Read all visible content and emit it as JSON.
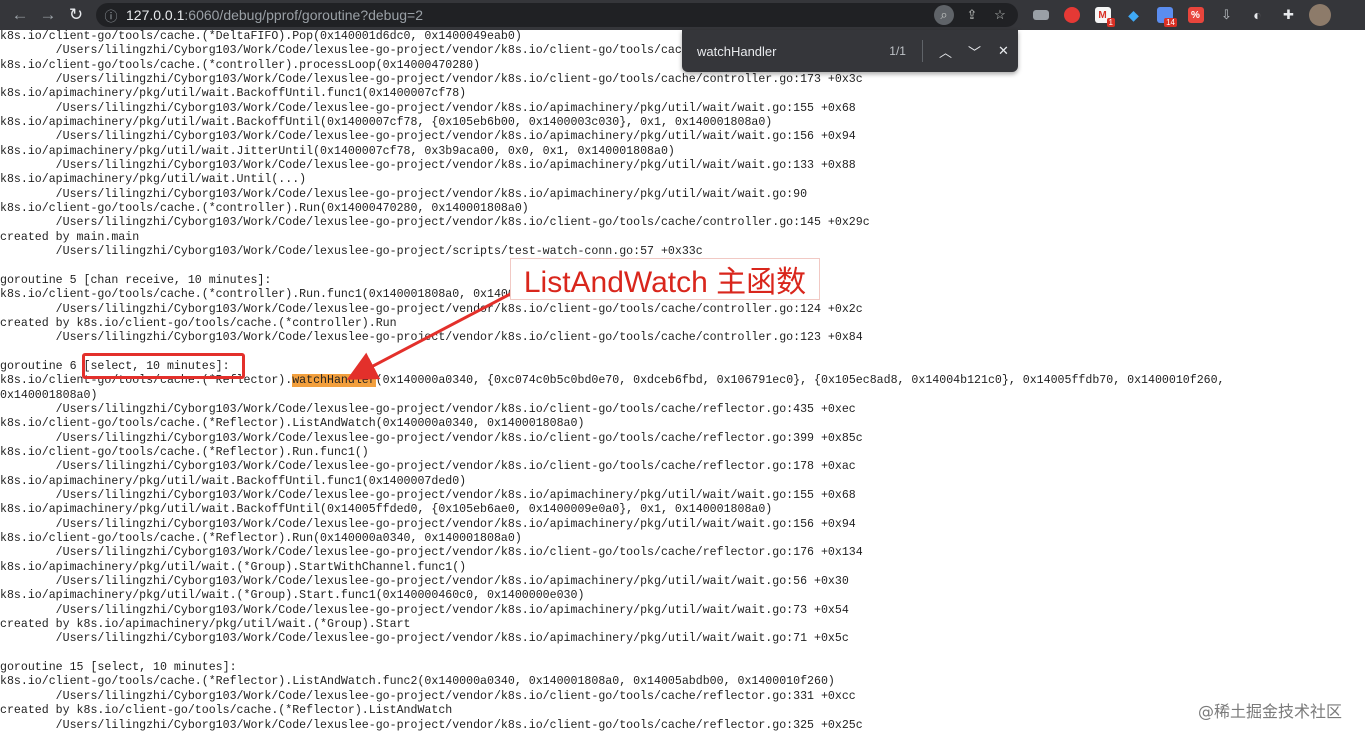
{
  "browser": {
    "url_host": "127.0.0.1",
    "url_rest": ":6060/debug/pprof/goroutine?debug=2",
    "extension_badges": [
      "1",
      "14"
    ]
  },
  "find_bar": {
    "query": "watchHandler",
    "match_count": "1/1"
  },
  "lines": [
    "k8s.io/client-go/tools/cache.(*DeltaFIFO).Pop(0x140001d6dc0, 0x1400049eab0)",
    "        /Users/lilingzhi/Cyborg103/Work/Code/lexuslee-go-project/vendor/k8s.io/client-go/tools/cache/delta_fifo.go:507 +0x1f0",
    "k8s.io/client-go/tools/cache.(*controller).processLoop(0x14000470280)",
    "        /Users/lilingzhi/Cyborg103/Work/Code/lexuslee-go-project/vendor/k8s.io/client-go/tools/cache/controller.go:173 +0x3c",
    "k8s.io/apimachinery/pkg/util/wait.BackoffUntil.func1(0x1400007cf78)",
    "        /Users/lilingzhi/Cyborg103/Work/Code/lexuslee-go-project/vendor/k8s.io/apimachinery/pkg/util/wait/wait.go:155 +0x68",
    "k8s.io/apimachinery/pkg/util/wait.BackoffUntil(0x1400007cf78, {0x105eb6b00, 0x1400003c030}, 0x1, 0x140001808a0)",
    "        /Users/lilingzhi/Cyborg103/Work/Code/lexuslee-go-project/vendor/k8s.io/apimachinery/pkg/util/wait/wait.go:156 +0x94",
    "k8s.io/apimachinery/pkg/util/wait.JitterUntil(0x1400007cf78, 0x3b9aca00, 0x0, 0x1, 0x140001808a0)",
    "        /Users/lilingzhi/Cyborg103/Work/Code/lexuslee-go-project/vendor/k8s.io/apimachinery/pkg/util/wait/wait.go:133 +0x88",
    "k8s.io/apimachinery/pkg/util/wait.Until(...)",
    "        /Users/lilingzhi/Cyborg103/Work/Code/lexuslee-go-project/vendor/k8s.io/apimachinery/pkg/util/wait/wait.go:90",
    "k8s.io/client-go/tools/cache.(*controller).Run(0x14000470280, 0x140001808a0)",
    "        /Users/lilingzhi/Cyborg103/Work/Code/lexuslee-go-project/vendor/k8s.io/client-go/tools/cache/controller.go:145 +0x29c",
    "created by main.main",
    "        /Users/lilingzhi/Cyborg103/Work/Code/lexuslee-go-project/scripts/test-watch-conn.go:57 +0x33c",
    "",
    "goroutine 5 [chan receive, 10 minutes]:",
    "k8s.io/client-go/tools/cache.(*controller).Run.func1(0x140001808a0, 0x14000470280)",
    "        /Users/lilingzhi/Cyborg103/Work/Code/lexuslee-go-project/vendor/k8s.io/client-go/tools/cache/controller.go:124 +0x2c",
    "created by k8s.io/client-go/tools/cache.(*controller).Run",
    "        /Users/lilingzhi/Cyborg103/Work/Code/lexuslee-go-project/vendor/k8s.io/client-go/tools/cache/controller.go:123 +0x84",
    "",
    "goroutine 6 [select, 10 minutes]:",
    "k8s.io/client-go/tools/cache.(*Reflector).",
    "(0x140000a0340, {0xc074c0b5c0bd0e70, 0xdceb6fbd, 0x106791ec0}, {0x105ec8ad8, 0x14004b121c0}, 0x14005ffdb70, 0x1400010f260,",
    "0x140001808a0)",
    "        /Users/lilingzhi/Cyborg103/Work/Code/lexuslee-go-project/vendor/k8s.io/client-go/tools/cache/reflector.go:435 +0xec",
    "k8s.io/client-go/tools/cache.(*Reflector).ListAndWatch(0x140000a0340, 0x140001808a0)",
    "        /Users/lilingzhi/Cyborg103/Work/Code/lexuslee-go-project/vendor/k8s.io/client-go/tools/cache/reflector.go:399 +0x85c",
    "k8s.io/client-go/tools/cache.(*Reflector).Run.func1()",
    "        /Users/lilingzhi/Cyborg103/Work/Code/lexuslee-go-project/vendor/k8s.io/client-go/tools/cache/reflector.go:178 +0xac",
    "k8s.io/apimachinery/pkg/util/wait.BackoffUntil.func1(0x1400007ded0)",
    "        /Users/lilingzhi/Cyborg103/Work/Code/lexuslee-go-project/vendor/k8s.io/apimachinery/pkg/util/wait/wait.go:155 +0x68",
    "k8s.io/apimachinery/pkg/util/wait.BackoffUntil(0x14005ffded0, {0x105eb6ae0, 0x1400009e0a0}, 0x1, 0x140001808a0)",
    "        /Users/lilingzhi/Cyborg103/Work/Code/lexuslee-go-project/vendor/k8s.io/apimachinery/pkg/util/wait/wait.go:156 +0x94",
    "k8s.io/client-go/tools/cache.(*Reflector).Run(0x140000a0340, 0x140001808a0)",
    "        /Users/lilingzhi/Cyborg103/Work/Code/lexuslee-go-project/vendor/k8s.io/client-go/tools/cache/reflector.go:176 +0x134",
    "k8s.io/apimachinery/pkg/util/wait.(*Group).StartWithChannel.func1()",
    "        /Users/lilingzhi/Cyborg103/Work/Code/lexuslee-go-project/vendor/k8s.io/apimachinery/pkg/util/wait/wait.go:56 +0x30",
    "k8s.io/apimachinery/pkg/util/wait.(*Group).Start.func1(0x140000460c0, 0x1400000e030)",
    "        /Users/lilingzhi/Cyborg103/Work/Code/lexuslee-go-project/vendor/k8s.io/apimachinery/pkg/util/wait/wait.go:73 +0x54",
    "created by k8s.io/apimachinery/pkg/util/wait.(*Group).Start",
    "        /Users/lilingzhi/Cyborg103/Work/Code/lexuslee-go-project/vendor/k8s.io/apimachinery/pkg/util/wait/wait.go:71 +0x5c",
    "",
    "goroutine 15 [select, 10 minutes]:",
    "k8s.io/client-go/tools/cache.(*Reflector).ListAndWatch.func2(0x140000a0340, 0x140001808a0, 0x14005abdb00, 0x1400010f260)",
    "        /Users/lilingzhi/Cyborg103/Work/Code/lexuslee-go-project/vendor/k8s.io/client-go/tools/cache/reflector.go:331 +0xcc",
    "created by k8s.io/client-go/tools/cache.(*Reflector).ListAndWatch",
    "        /Users/lilingzhi/Cyborg103/Work/Code/lexuslee-go-project/vendor/k8s.io/client-go/tools/cache/reflector.go:325 +0x25c"
  ],
  "highlight_word": "watchHandler",
  "annotation": {
    "callout_text": "ListAndWatch 主函数"
  },
  "watermark": "@稀土掘金技术社区",
  "colors": {
    "highlight": "#f29f3d",
    "annotation_red": "#e3302b"
  }
}
